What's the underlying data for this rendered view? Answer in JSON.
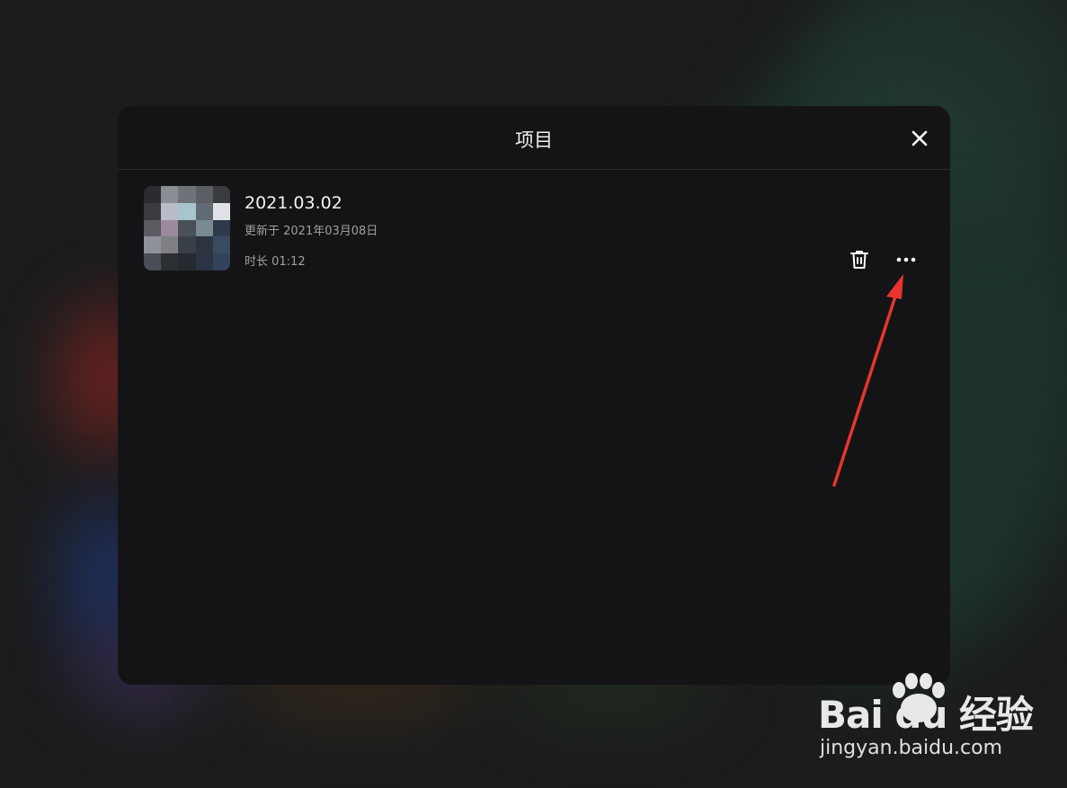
{
  "modal": {
    "title": "项目",
    "close_icon": "close-icon"
  },
  "project": {
    "name": "2021.03.02",
    "updated": "更新于 2021年03月08日",
    "duration": "时长 01:12",
    "delete_icon": "trash-icon",
    "more_icon": "more-horizontal-icon"
  },
  "annotation": {
    "arrow_color": "#e8342f"
  },
  "watermark": {
    "logo_text": "Bai du 经验",
    "url": "jingyan.baidu.com"
  },
  "colors": {
    "modal_bg": "#141416",
    "page_bg": "#1b1c1d",
    "primary_text": "#f4f4f4",
    "secondary_text": "#a0a0a3"
  }
}
